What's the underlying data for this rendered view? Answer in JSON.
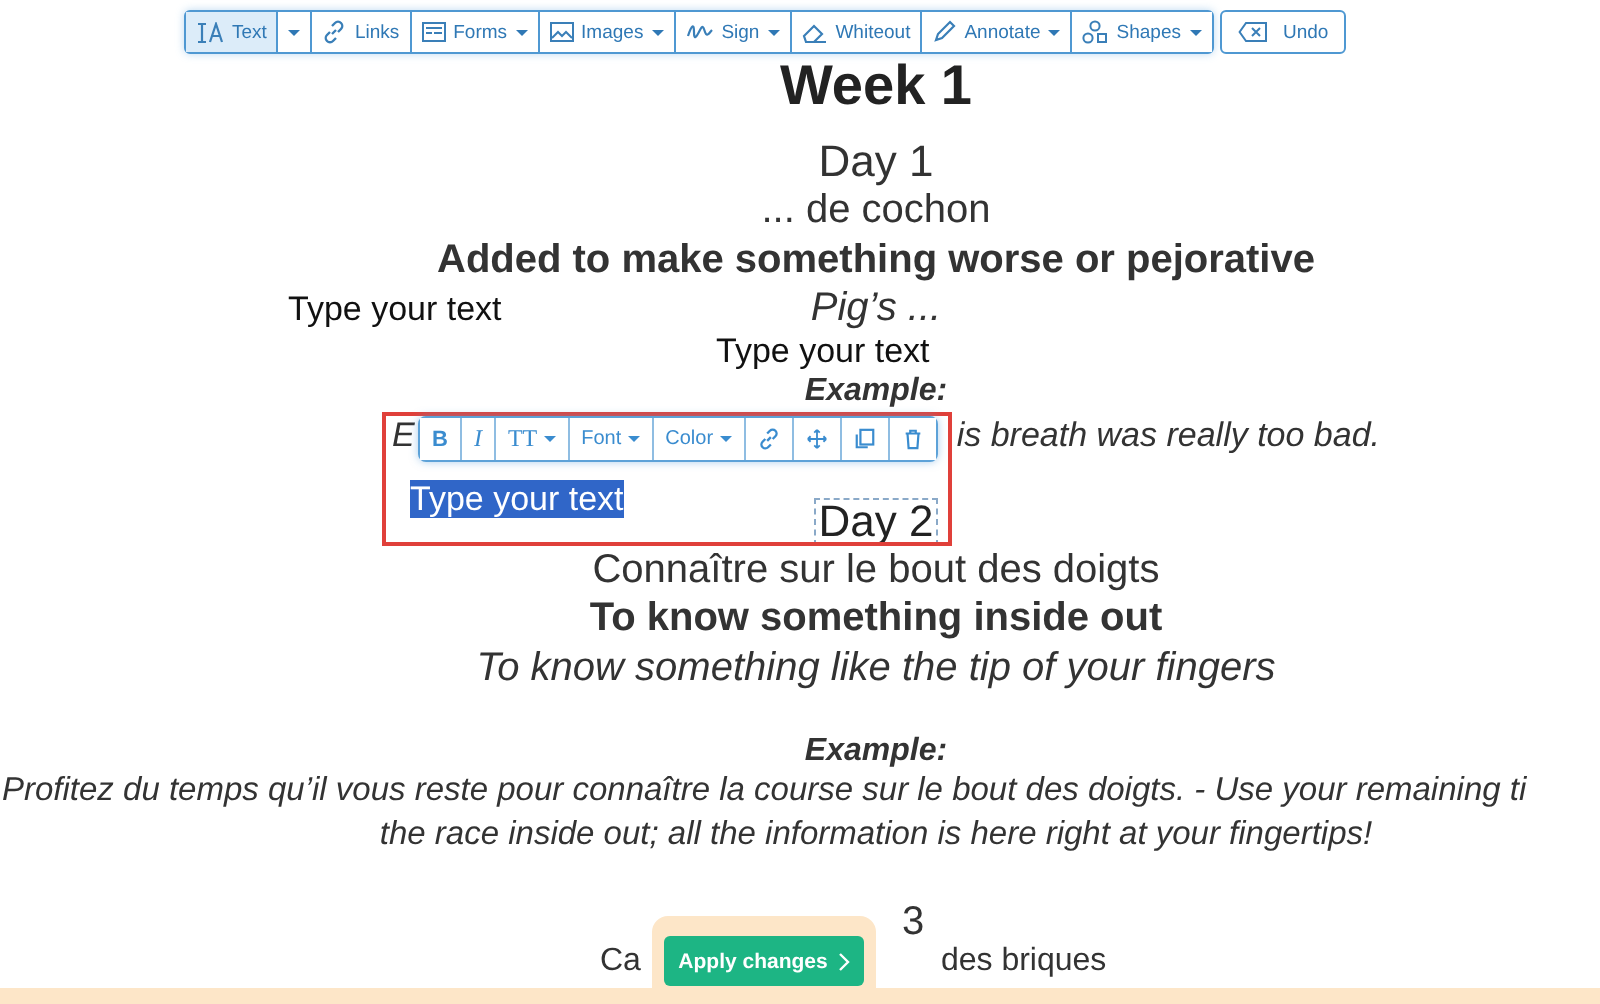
{
  "toolbar": {
    "items": [
      {
        "label": "Text",
        "selected": true,
        "dropdown": false
      },
      {
        "selected": false,
        "dropdown": true
      },
      {
        "label": "Links",
        "selected": false,
        "dropdown": false
      },
      {
        "label": "Forms",
        "selected": false,
        "dropdown": true
      },
      {
        "label": "Images",
        "selected": false,
        "dropdown": true
      },
      {
        "label": "Sign",
        "selected": false,
        "dropdown": true
      },
      {
        "label": "Whiteout",
        "selected": false,
        "dropdown": false
      },
      {
        "label": "Annotate",
        "selected": false,
        "dropdown": true
      },
      {
        "label": "Shapes",
        "selected": false,
        "dropdown": true
      }
    ],
    "undo": "Undo"
  },
  "document": {
    "paragraphs": [
      {
        "lines": [
          {
            "kind": "heading",
            "parts": [
              "Week 1"
            ]
          }
        ]
      },
      {
        "lines": [
          {
            "kind": "day",
            "parts": [
              "Day 1"
            ]
          },
          {
            "kind": "plain",
            "parts": [
              "... de cochon"
            ]
          },
          {
            "kind": "bold",
            "parts": [
              "Added to make something worse or pejorative"
            ]
          },
          {
            "kind": "italic",
            "parts": [
              "Pig’s ..."
            ]
          },
          {
            "kind": "example",
            "parts": [
              "Example:"
            ]
          },
          {
            "kind": "split",
            "parts": [
              "E",
              "is breath was really too bad."
            ]
          },
          {
            "kind": "boxed",
            "parts": [
              "Day 2"
            ]
          },
          {
            "kind": "plain",
            "parts": [
              "Connaître sur le bout des doigts"
            ]
          },
          {
            "kind": "bold",
            "parts": [
              "To know something inside out"
            ]
          },
          {
            "kind": "italic",
            "parts": [
              "To know something like the tip of your fingers"
            ]
          },
          {
            "kind": "example",
            "parts": [
              "Example:"
            ]
          },
          {
            "kind": "sentence-cut",
            "parts": [
              "Profitez du temps qu’il vous reste pour connaître la course sur le bout des doigts. - Use your remaining ti"
            ]
          },
          {
            "kind": "sentence",
            "parts": [
              "the race inside out; all the information is here right at your fingertips!"
            ]
          },
          {
            "kind": "tail",
            "parts": [
              "3"
            ]
          },
          {
            "kind": "split-bottom",
            "parts": [
              "Ca",
              "des briques"
            ]
          }
        ]
      }
    ]
  },
  "annotations": [
    "Type your text",
    "Type your text"
  ],
  "editor": {
    "selected_text": "Type your text",
    "tools": [
      {
        "kind": "bold",
        "label": "B",
        "dropdown": false
      },
      {
        "kind": "italic",
        "label": "I",
        "dropdown": false
      },
      {
        "kind": "size",
        "label": "TT",
        "dropdown": true
      },
      {
        "kind": "font",
        "label": "Font",
        "dropdown": true
      },
      {
        "kind": "color",
        "label": "Color",
        "dropdown": true
      },
      {
        "kind": "link",
        "dropdown": false
      },
      {
        "kind": "move",
        "dropdown": false
      },
      {
        "kind": "copy",
        "dropdown": false
      },
      {
        "kind": "delete",
        "dropdown": false
      }
    ]
  },
  "apply_button": "Apply changes"
}
